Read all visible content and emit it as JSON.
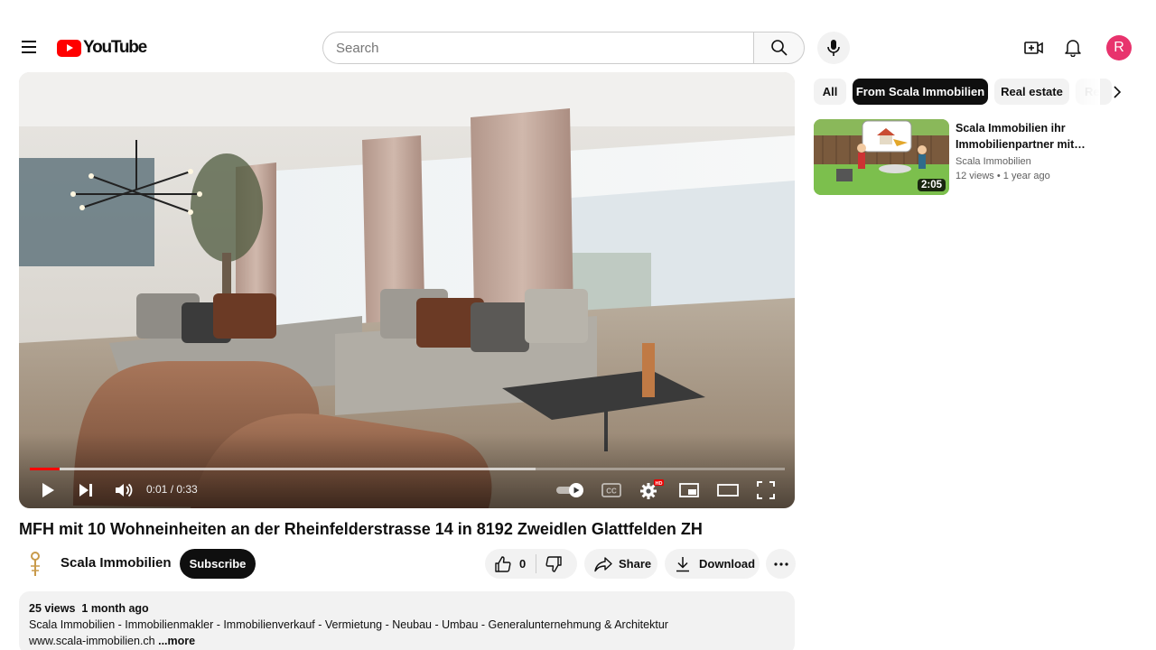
{
  "header": {
    "logo_text": "YouTube",
    "search_placeholder": "Search",
    "avatar_letter": "R",
    "colors": {
      "brand": "#ff0000",
      "avatar": "#e8336d"
    },
    "icons": [
      "menu-icon",
      "search-icon",
      "mic-icon",
      "create-icon",
      "bell-icon"
    ]
  },
  "player": {
    "current_time": "0:01",
    "duration": "0:33",
    "progress_played": 0.04,
    "progress_loaded": 0.67,
    "hd_badge": "HD",
    "controls": [
      "play-icon",
      "next-icon",
      "volume-icon",
      "autoplay-toggle",
      "captions-icon",
      "settings-icon",
      "miniplayer-icon",
      "theater-icon",
      "fullscreen-icon"
    ]
  },
  "video": {
    "title": "MFH mit 10 Wohneinheiten an der Rheinfelderstrasse 14 in 8192 Zweidlen Glattfelden ZH",
    "channel": "Scala Immobilien",
    "subscribe_label": "Subscribe",
    "like_count": "0",
    "share_label": "Share",
    "download_label": "Download"
  },
  "description": {
    "views": "25 views",
    "date": "1 month ago",
    "line1": "Scala Immobilien - Immobilienmakler - Immobilienverkauf - Vermietung - Neubau - Umbau - Generalunternehmung & Architektur",
    "line2": "www.scala-immobilien.ch",
    "more_label": "...more"
  },
  "chips": [
    {
      "label": "All",
      "active": false
    },
    {
      "label": "From Scala Immobilien",
      "active": true
    },
    {
      "label": "Real estate",
      "active": false
    },
    {
      "label": "Re",
      "active": false
    }
  ],
  "related": [
    {
      "title": "Scala Immobilien ihr Immobilienpartner mit…",
      "channel": "Scala Immobilien",
      "views": "12 views",
      "age": "1 year ago",
      "duration": "2:05"
    }
  ]
}
